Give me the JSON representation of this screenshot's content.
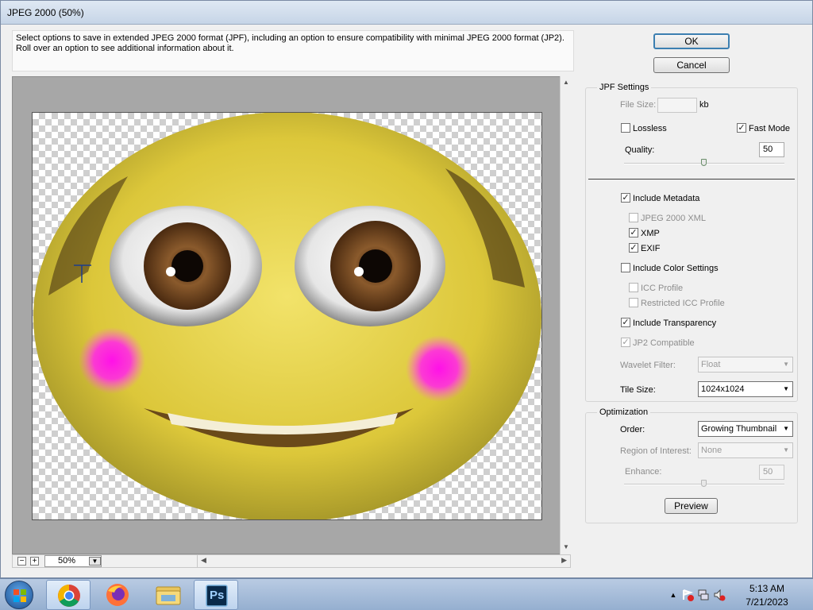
{
  "window": {
    "title": "JPEG 2000 (50%)"
  },
  "description": "Select options to save in extended JPEG 2000 format (JPF), including an option to ensure compatibility with minimal JPEG 2000 format (JP2). Roll over an option to see additional information about it.",
  "buttons": {
    "ok": "OK",
    "cancel": "Cancel",
    "preview": "Preview"
  },
  "zoom": {
    "value": "50%",
    "minus": "−",
    "plus": "+"
  },
  "jpf": {
    "legend": "JPF Settings",
    "file_size_label": "File Size:",
    "file_size_unit": "kb",
    "file_size_value": "",
    "lossless_label": "Lossless",
    "lossless_checked": false,
    "fast_mode_label": "Fast Mode",
    "fast_mode_checked": true,
    "quality_label": "Quality:",
    "quality_value": "50"
  },
  "metadata": {
    "include_metadata": "Include Metadata",
    "jpeg2000_xml": "JPEG 2000 XML",
    "xmp": "XMP",
    "exif": "EXIF",
    "include_color_settings": "Include Color Settings",
    "icc_profile": "ICC Profile",
    "restricted_icc_profile": "Restricted ICC Profile",
    "include_transparency": "Include Transparency",
    "jp2_compatible": "JP2 Compatible",
    "wavelet_filter_label": "Wavelet Filter:",
    "wavelet_filter_value": "Float",
    "tile_size_label": "Tile Size:",
    "tile_size_value": "1024x1024"
  },
  "optimization": {
    "legend": "Optimization",
    "order_label": "Order:",
    "order_value": "Growing Thumbnail",
    "roi_label": "Region of Interest:",
    "roi_value": "None",
    "enhance_label": "Enhance:",
    "enhance_value": "50"
  },
  "taskbar": {
    "apps": [
      "start-button",
      "chrome-icon",
      "firefox-icon",
      "file-explorer-icon",
      "photoshop-icon"
    ],
    "ps_label": "Ps",
    "time": "5:13 AM",
    "date": "7/21/2023"
  },
  "colors": {
    "accent": "#3c7fb1",
    "skin": "#e8d24a",
    "blush": "#ff1ee0"
  }
}
